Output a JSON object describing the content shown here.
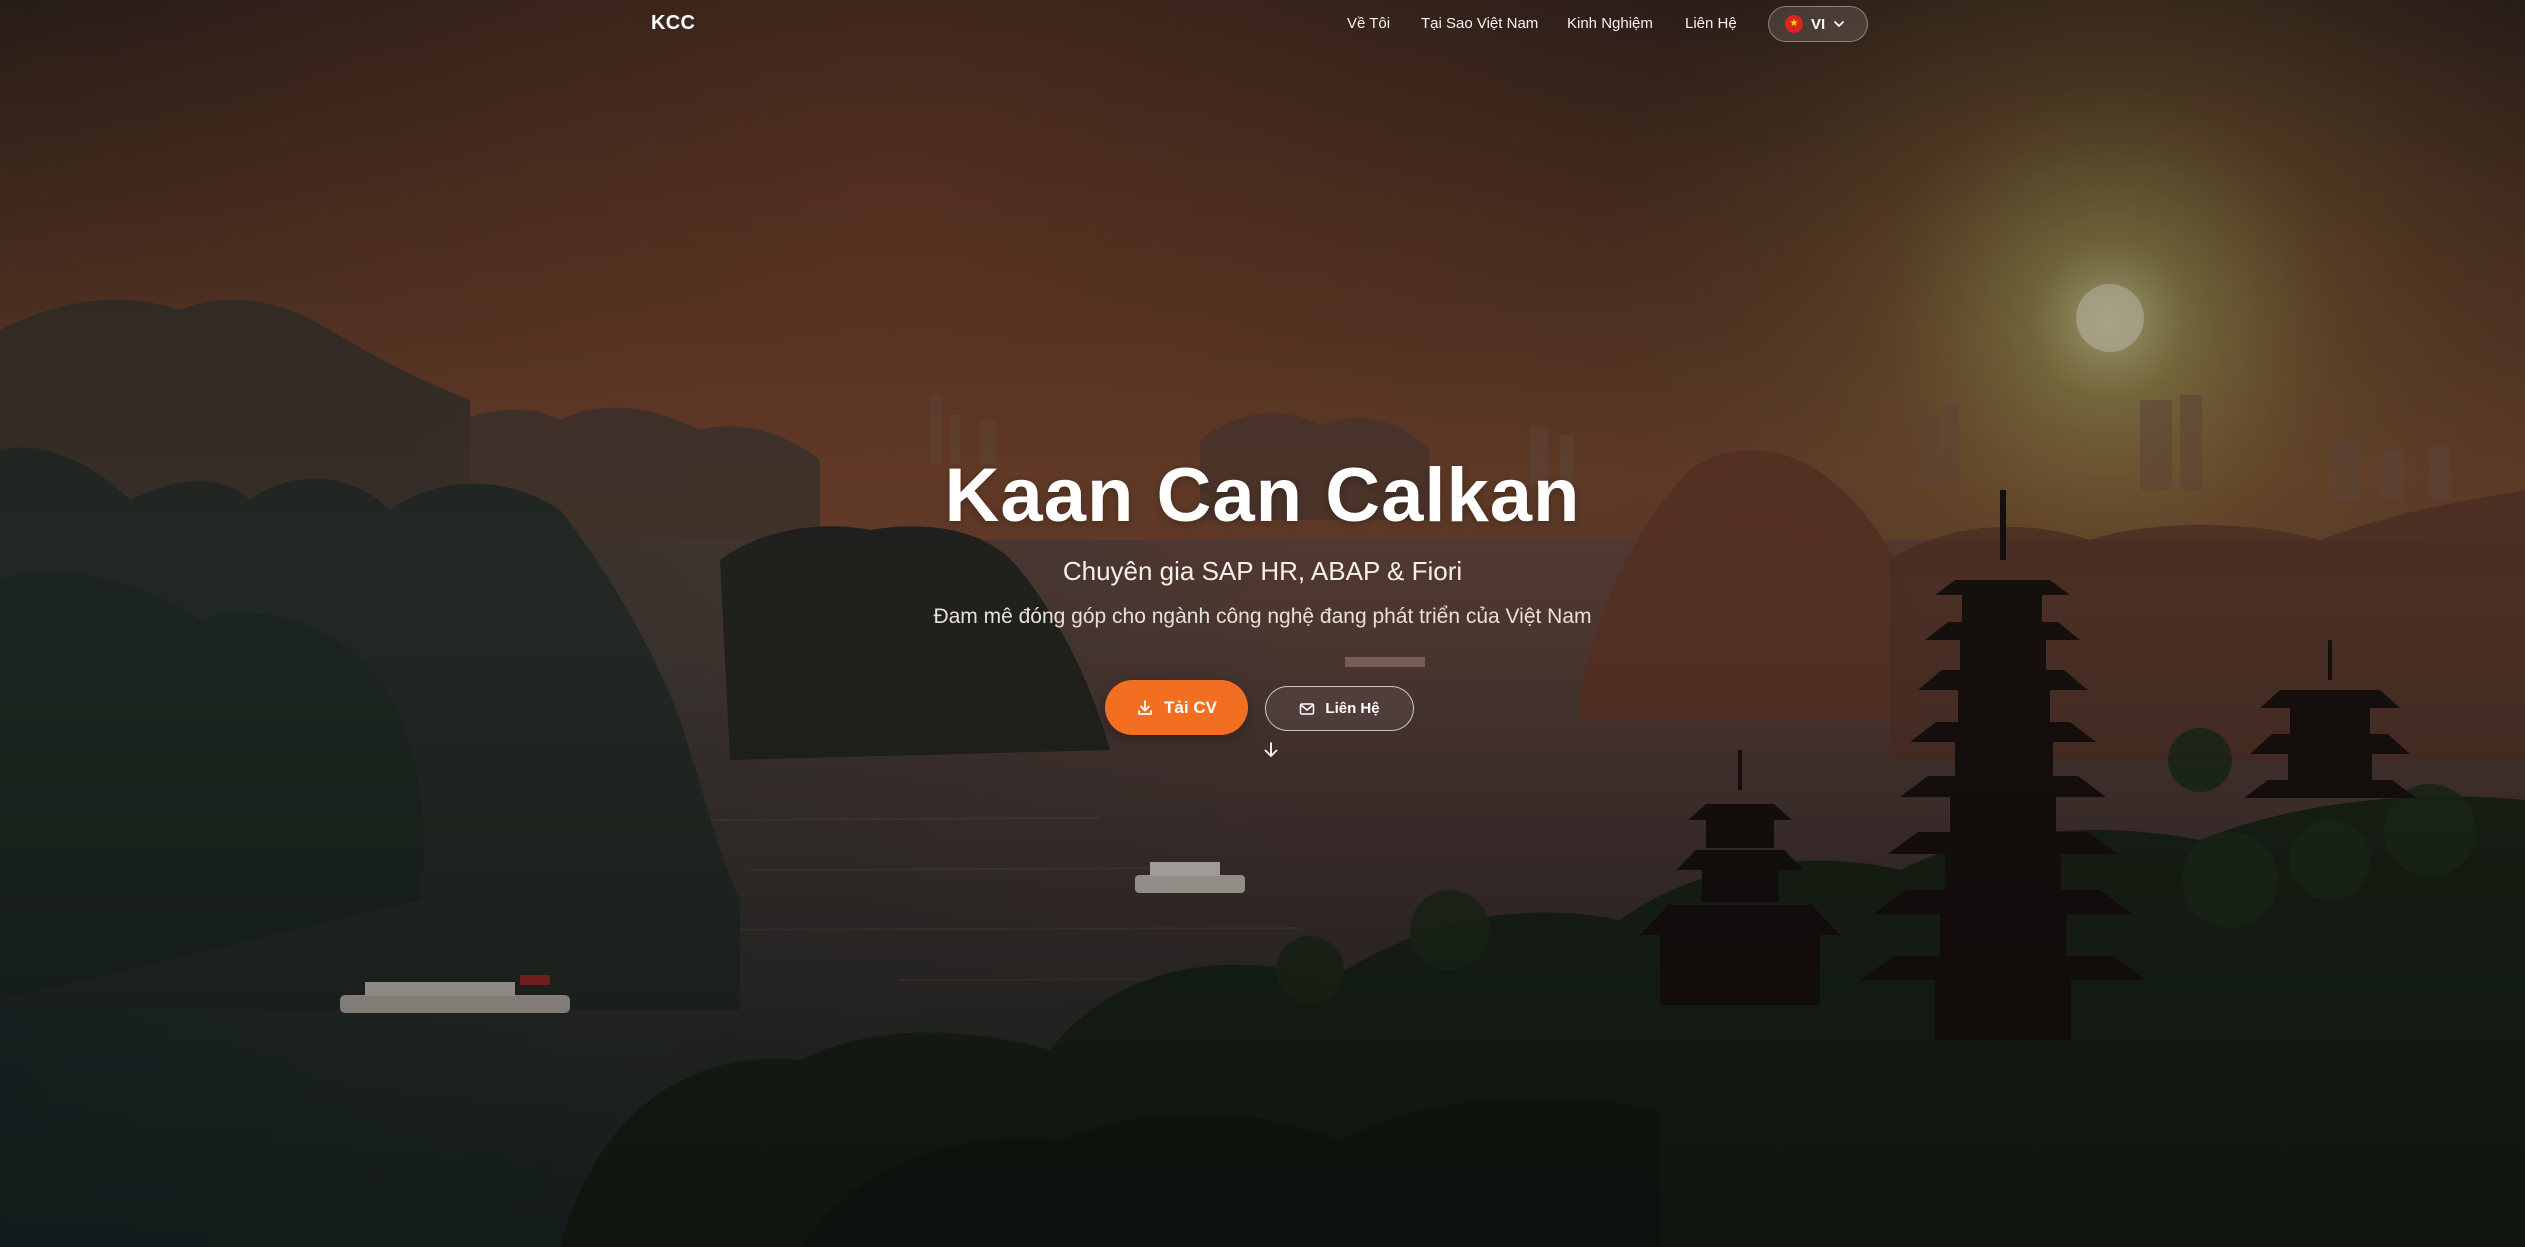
{
  "brand": {
    "logo": "KCC"
  },
  "nav": {
    "items": [
      {
        "label": "Về Tôi"
      },
      {
        "label": "Tại Sao Việt Nam"
      },
      {
        "label": "Kinh Nghiệm"
      },
      {
        "label": "Liên Hệ"
      }
    ],
    "language": {
      "current": "VI",
      "flag_icon": "vietnam-flag-icon"
    }
  },
  "hero": {
    "name": "Kaan Can Calkan",
    "subtitle": "Chuyên gia SAP HR, ABAP & Fiori",
    "tagline": "Đam mê đóng góp cho ngành công nghệ đang phát triển của Việt Nam",
    "primary_button": {
      "label": "Tải CV",
      "icon": "download-icon"
    },
    "secondary_button": {
      "label": "Liên Hệ",
      "icon": "mail-icon"
    },
    "scroll_icon": "arrow-down-icon"
  },
  "colors": {
    "accent": "#f26f21",
    "text": "#ffffff"
  }
}
